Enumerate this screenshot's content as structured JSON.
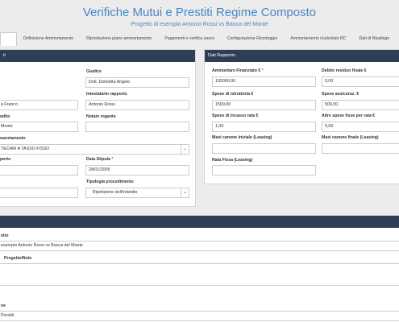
{
  "header": {
    "title": "Verifiche Mutui e Prestiti Regime Composto",
    "subtitle": "Progetto di esempio Antonio Rossi vs Banca del Monte"
  },
  "tabs": [
    {
      "label": ""
    },
    {
      "label": "Definizione Ammortamento"
    },
    {
      "label": "Riproduzione piano ammortamento"
    },
    {
      "label": "Pagamenti e verifica usura"
    },
    {
      "label": "Configurazione Ricorteggio"
    },
    {
      "label": "Ammortamento ricalcolato RC"
    },
    {
      "label": "Dati di Riepilogo"
    }
  ],
  "left_panel": {
    "header": "ti",
    "giudice_label": "Giudice",
    "giudice_value": "Dott. Dolnietta Angelo",
    "val1": "a Franco",
    "intestatario_label": "Intestatario rapporto",
    "intestatario_value": "Antonio Rossi",
    "lbl_edito": "edito",
    "notaio_label": "Notaio rogante",
    "val_monte": "Monte",
    "lbl_finanziamento": "nanziamento",
    "tipo_value": "TECARI A TASSO FISSO",
    "lbl_porto": "porto",
    "data_stipula_label": "Data Stipula",
    "data_stipula_value": "28/01/2005",
    "tipologia_label": "Tipologia procedimento",
    "tipologia_value": "Ripetizione dell'indebito"
  },
  "right_panel": {
    "header": "Dati Rapporto",
    "ammontare_label": "Ammontare Finanziato €",
    "ammontare_value": "100000,00",
    "debito_label": "Debito residuo finale €",
    "debito_value": "0,00",
    "istruttoria_label": "Spese di istruttoria €",
    "istruttoria_value": "1500,00",
    "assicuraz_label": "Spese assicuraz. €",
    "assicuraz_value": "500,00",
    "incasso_label": "Spese di incasso rata €",
    "incasso_value": "1,00",
    "altre_label": "Altre spese fisse per rata €",
    "altre_value": "0,00",
    "maxi_iniziale_label": "Maxi canone iniziale (Leasing)",
    "maxi_finale_label": "Maxi canone finale (Leasing)",
    "rata_fissa_label": "Rata Fissa (Leasing)"
  },
  "bottom_panel": {
    "lbl_titolo": "etto",
    "titolo_value": "esempio Antonio Rossi vs Banca del Monte",
    "lbl_note": "Progetto/Note",
    "lbl_ne": "ne",
    "val_prestiti": "Prestiti"
  },
  "colors": {
    "accent": "#4a86c5",
    "panel_header": "#2e3e56",
    "required": "#d9534f"
  }
}
